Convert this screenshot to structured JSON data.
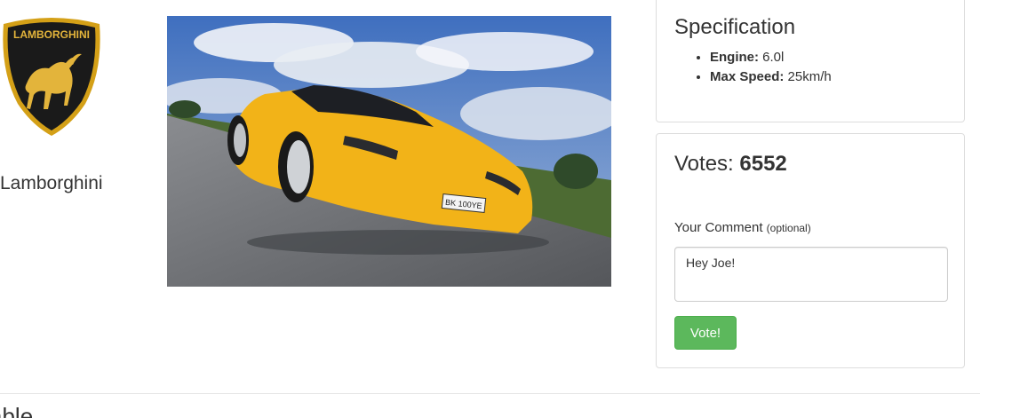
{
  "brand": {
    "name": "Lamborghini",
    "logo_icon": "lamborghini-bull-shield-logo",
    "logo_text": "LAMBORGHINI",
    "logo_colors": {
      "shield": "#1a1a1a",
      "border": "#d4a017",
      "emblem": "#e3b43b"
    }
  },
  "car_photo": {
    "icon": "yellow-sports-car-photo",
    "plate_text": "BK 100YE",
    "colors": {
      "sky": "#4f7fc6",
      "car": "#f2b318",
      "road": "#6b6e74",
      "grass": "#4d6b33"
    }
  },
  "spec": {
    "title": "Specification",
    "items": [
      {
        "label": "Engine:",
        "value": "6.0l"
      },
      {
        "label": "Max Speed:",
        "value": "25km/h"
      }
    ]
  },
  "vote": {
    "votes_label": "Votes:",
    "votes_count": "6552",
    "comment_label": "Your Comment",
    "comment_optional": "(optional)",
    "comment_value": "Hey Joe!",
    "button_label": "Vote!",
    "button_color": "#5cb85c"
  },
  "bottom": {
    "heading": "able"
  }
}
